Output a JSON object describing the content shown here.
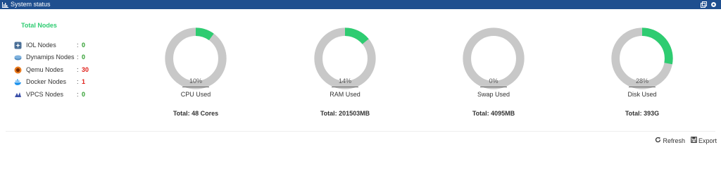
{
  "header": {
    "title": "System status",
    "icon": "bar-chart-icon"
  },
  "header_tools": [
    {
      "icon": "window-icon"
    },
    {
      "icon": "gear-icon"
    }
  ],
  "nodes": {
    "title": "Total Nodes",
    "items": [
      {
        "name": "IOL Nodes",
        "separator": ":",
        "count": "0",
        "color": "#2e9e2e",
        "icon": "iol-icon"
      },
      {
        "name": "Dynamips Nodes",
        "separator": ":",
        "count": "0",
        "color": "#2e9e2e",
        "icon": "router-icon"
      },
      {
        "name": "Qemu Nodes",
        "separator": ":",
        "count": "30",
        "color": "#e0201a",
        "icon": "qemu-icon"
      },
      {
        "name": "Docker Nodes",
        "separator": ":",
        "count": "1",
        "color": "#e0201a",
        "icon": "docker-icon"
      },
      {
        "name": "VPCS Nodes",
        "separator": ":",
        "count": "0",
        "color": "#2e9e2e",
        "icon": "vpcs-icon"
      }
    ]
  },
  "gauges": [
    {
      "percent": "10%",
      "value": 10,
      "label": "CPU Used",
      "total": "Total: 48 Cores"
    },
    {
      "percent": "14%",
      "value": 14,
      "label": "RAM Used",
      "total": "Total: 201503MB"
    },
    {
      "percent": "0%",
      "value": 0,
      "label": "Swap Used",
      "total": "Total: 4095MB"
    },
    {
      "percent": "28%",
      "value": 28,
      "label": "Disk Used",
      "total": "Total: 393G"
    }
  ],
  "colors": {
    "used": "#2ecc71",
    "free": "#c8c8c8",
    "header_bg": "#1f4f8f"
  },
  "footer": {
    "refresh_label": "Refresh",
    "export_label": "Export"
  }
}
